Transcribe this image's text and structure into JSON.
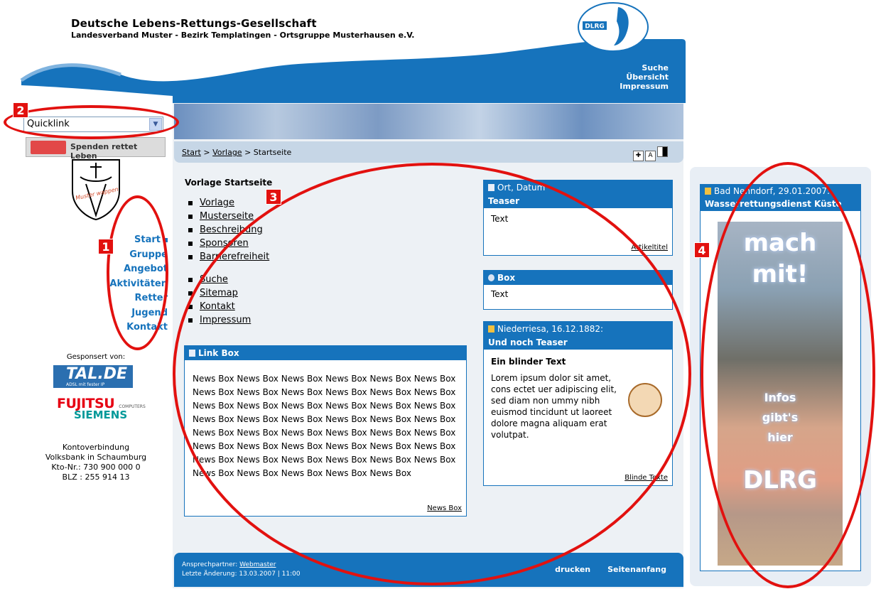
{
  "header": {
    "org_name": "Deutsche Lebens-Rettungs-Gesellschaft",
    "org_sub": "Landesverband Muster - Bezirk Templatingen - Ortsgruppe Musterhausen e.V.",
    "logo_text": "DLRG",
    "top_links": [
      "Suche",
      "Übersicht",
      "Impressum"
    ],
    "colors": {
      "accent": "#1673bc",
      "wave": "#1673bc",
      "annotation": "#e2110f"
    }
  },
  "quicklink": {
    "value": "Quicklink"
  },
  "spenden": {
    "label": "Spenden rettet Leben"
  },
  "crest": {
    "text": "Muster wappen"
  },
  "left_nav": [
    "Start",
    "Gruppe",
    "Angebot",
    "Aktivitäten",
    "Retter",
    "Jugend",
    "Kontakt"
  ],
  "sponsors": {
    "label": "Gesponsert von:",
    "talde": "TAL.DE",
    "talde_sub": "ADSL mit fester IP",
    "fujitsu": "FUJITSU",
    "fujitsu_sub": "COMPUTERS",
    "siemens": "SIEMENS"
  },
  "konto": [
    "Kontoverbindung",
    "Volksbank in Schaumburg",
    "Kto-Nr.: 730 900 000 0",
    "BLZ : 255 914 13"
  ],
  "breadcrumb": {
    "start": "Start",
    "sep": " > ",
    "vorlage": "Vorlage",
    "current": "Startseite"
  },
  "content": {
    "title": "Vorlage Startseite",
    "menu1": [
      "Vorlage",
      "Musterseite",
      "Beschreibung",
      "Sponsoren",
      "Barrierefreiheit"
    ],
    "menu2": [
      "Suche",
      "Sitemap",
      "Kontakt",
      "Impressum"
    ]
  },
  "linkbox": {
    "title": "Link Box",
    "body": "News Box News Box News Box News Box News Box News Box News Box News Box News Box News Box News Box News Box News Box News Box News Box News Box News Box News Box News Box News Box News Box News Box News Box News Box News Box News Box News Box News Box News Box News Box News Box News Box News Box News Box News Box News Box News Box News Box News Box News Box News Box News Box News Box News Box News Box News Box News Box",
    "more": "News Box"
  },
  "teaser1": {
    "meta": "Ort, Datum",
    "title": "Teaser",
    "body": "Text",
    "more": "Artikeltitel"
  },
  "box2": {
    "title": "Box",
    "body": "Text"
  },
  "teaser2": {
    "meta": "Niederriesa, 16.12.1882:",
    "title": "Und noch Teaser",
    "subhead": "Ein blinder Text",
    "body": "Lorem ipsum dolor sit amet, cons ectet uer adipiscing elit, sed diam non ummy nibh euismod tincidunt ut laoreet dolore magna aliquam erat volutpat.",
    "more": "Blinde Texte"
  },
  "footer": {
    "contact_label": "Ansprechpartner:",
    "contact_link": "Webmaster",
    "changed": "Letzte Änderung: 13.03.2007 | 11:00",
    "print": "drucken",
    "top": "Seitenanfang"
  },
  "right": {
    "meta": "Bad Nenndorf, 29.01.2007:",
    "title": "Wasserrettungsdienst Küste",
    "ad": [
      "mach",
      "mit!",
      "Infos",
      "gibt's",
      "hier",
      "DLRG"
    ]
  },
  "markers": [
    "1",
    "2",
    "3",
    "4"
  ]
}
